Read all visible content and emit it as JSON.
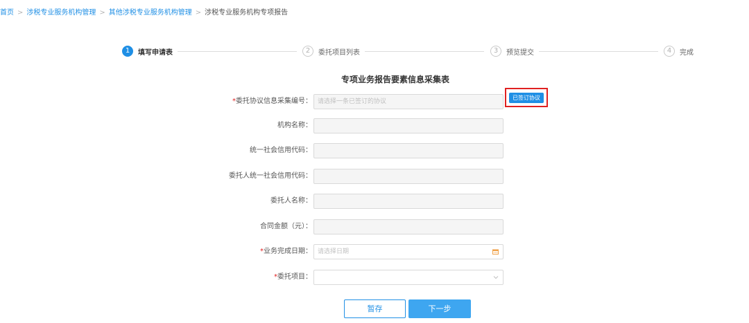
{
  "breadcrumb": [
    {
      "label": "首页",
      "link": true
    },
    {
      "label": "涉税专业服务机构管理",
      "link": true
    },
    {
      "label": "其他涉税专业服务机构管理",
      "link": true
    },
    {
      "label": "涉税专业服务机构专项报告",
      "link": false
    }
  ],
  "breadcrumb_separator": ">",
  "steps": [
    {
      "num": "1",
      "label": "填写申请表",
      "active": true
    },
    {
      "num": "2",
      "label": "委托项目列表",
      "active": false
    },
    {
      "num": "3",
      "label": "预览提交",
      "active": false
    },
    {
      "num": "4",
      "label": "完成",
      "active": false
    }
  ],
  "form": {
    "title": "专项业务报告要素信息采集表",
    "required_mark": "*",
    "fields": [
      {
        "label": "委托协议信息采集编号：",
        "required": true,
        "value": "",
        "placeholder": "请选择一条已签订的协议",
        "control": "text"
      },
      {
        "label": "机构名称：",
        "required": false,
        "value": "",
        "placeholder": "",
        "control": "text"
      },
      {
        "label": "统一社会信用代码：",
        "required": false,
        "value": "",
        "placeholder": "",
        "control": "text"
      },
      {
        "label": "委托人统一社会信用代码：",
        "required": false,
        "value": "",
        "placeholder": "",
        "control": "text"
      },
      {
        "label": "委托人名称：",
        "required": false,
        "value": "",
        "placeholder": "",
        "control": "text"
      },
      {
        "label": "合同金额（元）：",
        "required": false,
        "value": "",
        "placeholder": "",
        "control": "text"
      },
      {
        "label": "业务完成日期：",
        "required": true,
        "value": "",
        "placeholder": "请选择日期",
        "control": "date",
        "icon": "calendar-icon"
      },
      {
        "label": "委托项目：",
        "required": true,
        "value": "",
        "placeholder": "",
        "control": "select",
        "icon": "chevron-down-icon"
      }
    ],
    "signed_agreement_button": "已签订协议"
  },
  "buttons": {
    "save": "暂存",
    "next": "下一步"
  },
  "colors": {
    "primary": "#1f8fe5",
    "next_button": "#3ea6f0",
    "required": "#e02020",
    "highlight_box": "#e02020"
  }
}
